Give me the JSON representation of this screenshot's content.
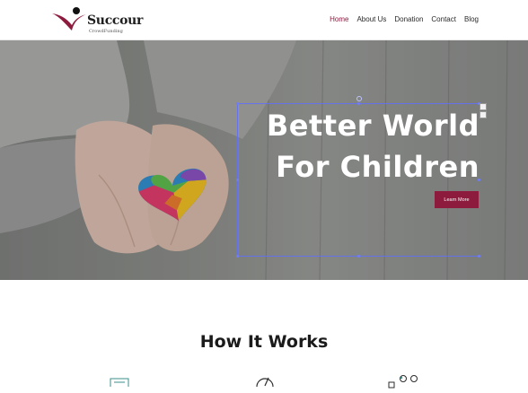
{
  "brand": {
    "name": "Succour",
    "tagline": "CrowdFunding",
    "accent_color": "#8d1b3d"
  },
  "nav": {
    "items": [
      {
        "label": "Home",
        "active": true
      },
      {
        "label": "About Us",
        "active": false
      },
      {
        "label": "Donation",
        "active": false
      },
      {
        "label": "Contact",
        "active": false
      },
      {
        "label": "Blog",
        "active": false
      }
    ]
  },
  "hero": {
    "title_line1": "Better World",
    "title_line2": "For Children",
    "button_label": "Learn More",
    "image_description_icon": "hands-holding-puzzle-heart"
  },
  "how_it_works": {
    "title": "How It Works",
    "icons": [
      "form-icon",
      "gauge-icon",
      "people-icon"
    ]
  }
}
